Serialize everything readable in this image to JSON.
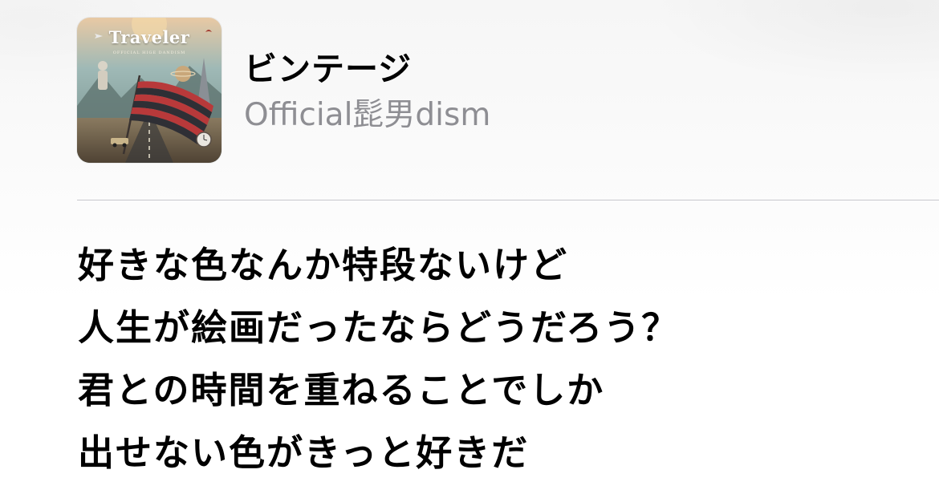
{
  "now_playing": {
    "artwork": {
      "title_text": "Traveler",
      "subtitle_text": "OFFICIAL HIGE DANDISM",
      "colors": {
        "sky": "#9fb9b6",
        "ground": "#7a6a55",
        "flag_red": "#b8393a",
        "flag_dark": "#2f2f35"
      }
    },
    "song_title": "ビンテージ",
    "artist": "Official髭男dism"
  },
  "lyrics": [
    "好きな色なんか特段ないけど",
    "人生が絵画だったならどうだろう？",
    "君との時間を重ねることでしか",
    "出せない色がきっと好きだ"
  ]
}
